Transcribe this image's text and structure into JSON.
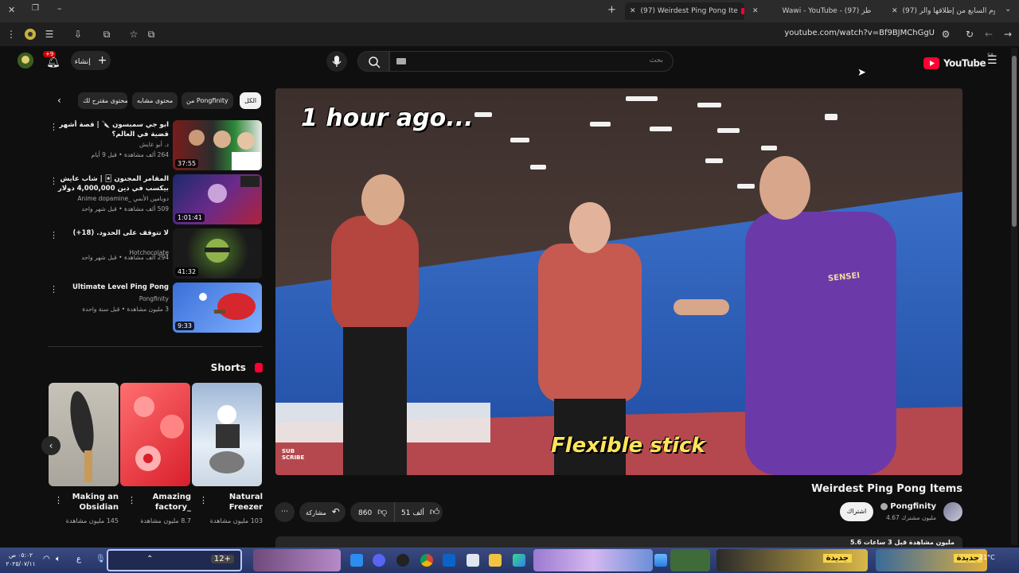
{
  "browser": {
    "tabs": [
      {
        "label": "(97) اليوم السابع من إطلاقها والر...",
        "active": false
      },
      {
        "label": "Wawi - YouTube - طز (97)",
        "active": false
      },
      {
        "label": "(97) Weirdest Ping Pong Ite",
        "active": true
      }
    ],
    "url": "youtube.com/watch?v=Bf9BJMChGgU"
  },
  "header": {
    "search_placeholder": "بحث",
    "create_label": "إنشاء",
    "notification_count": "+9",
    "logo_text": "YouTube",
    "region": "SA"
  },
  "chips": [
    {
      "label": "الكل",
      "selected": true
    },
    {
      "label": "من Pongfinity",
      "selected": false
    },
    {
      "label": "محتوى مشابه",
      "selected": false
    },
    {
      "label": "محتوى مقترح لك",
      "selected": false
    }
  ],
  "recommendations": [
    {
      "title": "ابو جي سمبسون 🔪 | قصة أشهر قضية في العالم؟",
      "channel": "د. أبو عايش",
      "meta": "264 ألف مشاهدة • قبل 9 أيام",
      "duration": "37:55",
      "theme": "a"
    },
    {
      "title": "المقامر المجنون 🃏 | شاب عايش بيكسب في دين 4,000,000 دولار 😱 | الموسم ...",
      "channel": "Anime dopamine_ دوبامين الأنمي",
      "meta": "509 ألف مشاهدة • قبل شهر واحد",
      "duration": "1:01:41",
      "theme": "b"
    },
    {
      "title": "لا تتوقف على الحدود. (18+)",
      "channel": "Hotchocolate",
      "meta": "294 ألف مشاهدة • قبل شهر واحد",
      "duration": "41:32",
      "theme": "c"
    },
    {
      "title": "Ultimate Level Ping Pong",
      "channel": "Pongfinity",
      "meta": "3 مليون مشاهدة • قبل سنة واحدة",
      "duration": "9:33",
      "theme": "d"
    }
  ],
  "shorts": {
    "heading": "Shorts",
    "items": [
      {
        "title": "Natural Freezer",
        "views": "103 مليون مشاهدة"
      },
      {
        "title": "Amazing factory_",
        "views": "8.7 مليون مشاهدة"
      },
      {
        "title": "Making an Obsidian",
        "views": "145 مليون مشاهدة"
      }
    ]
  },
  "video": {
    "overlay_top": "1 hour ago...",
    "caption": "Flexible stick",
    "watermark": "SUB SCRIBE",
    "shirt_text": "SENSEI",
    "title": "Weirdest Ping Pong Items",
    "channel": "Pongfinity",
    "subscribers": "4.67 مليون مشترك",
    "subscribe_label": "اشتراك",
    "likes": "51 ألف",
    "dislikes": "860",
    "share_label": "مشاركة",
    "partial_info": "5.6 مليون مشاهدة قبل 3 ساعات"
  },
  "taskbar": {
    "time": "٠٥:٠٢ ص",
    "date": "٢٠٢٥/٠٧/١١",
    "weather": "21°C",
    "lang": "ع",
    "badge": "12+",
    "news1": "جديدة",
    "news2": "جديدة"
  }
}
